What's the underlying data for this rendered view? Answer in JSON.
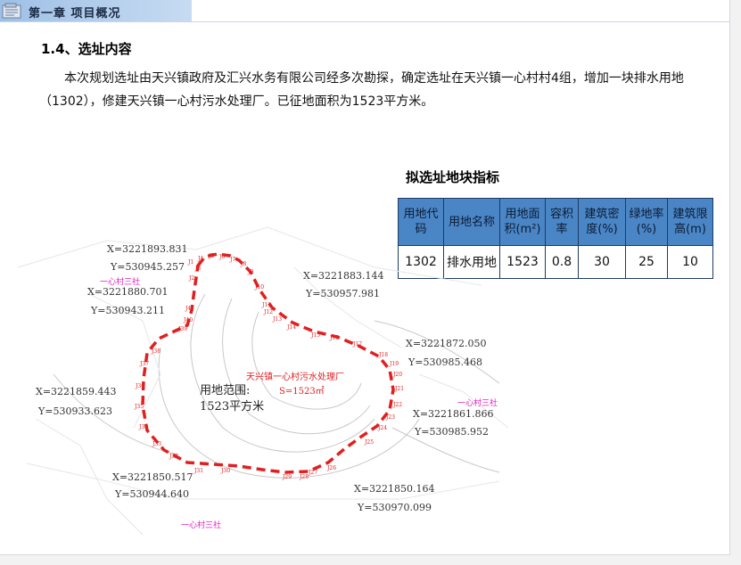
{
  "header": {
    "chapter_title": "第一章 项目概况",
    "icon": "folder-icon"
  },
  "section": {
    "title": "1.4、选址内容",
    "paragraph": "本次规划选址由天兴镇政府及汇兴水务有限公司经多次勘探，确定选址在天兴镇一心村村4组，增加一块排水用地（1302），修建天兴镇一心村污水处理厂。已征地面积为1523平方米。"
  },
  "table": {
    "title": "拟选址地块指标",
    "headers": [
      "用地代码",
      "用地名称",
      "用地面积(m²)",
      "容积率",
      "建筑密度(%)",
      "绿地率(%)",
      "建筑限高(m)"
    ],
    "rows": [
      [
        "1302",
        "排水用地",
        "1523",
        "0.8",
        "30",
        "25",
        "10"
      ]
    ],
    "header_color": "#4a86c5"
  },
  "map": {
    "boundary_color": "#e02020",
    "coords": [
      {
        "x": "X=3221893.831",
        "y": "Y=530945.257"
      },
      {
        "x": "X=3221880.701",
        "y": "Y=530943.211"
      },
      {
        "x": "X=3221883.144",
        "y": "Y=530957.981"
      },
      {
        "x": "X=3221872.050",
        "y": "Y=530985.468"
      },
      {
        "x": "X=3221859.443",
        "y": "Y=530933.623"
      },
      {
        "x": "X=3221861.866",
        "y": "Y=530985.952"
      },
      {
        "x": "X=3221850.517",
        "y": "Y=530944.640"
      },
      {
        "x": "X=3221850.164",
        "y": "Y=530970.099"
      }
    ],
    "village_labels": [
      "一心村三社",
      "一心村三社",
      "一心村三社"
    ],
    "area_label_1": "用地范围:",
    "area_label_2": "1523平方米",
    "plant_label": "天兴镇一心村污水处理厂",
    "plant_area": "S=1523㎡",
    "points": [
      "J1",
      "J2",
      "J3",
      "J4",
      "J5",
      "J6",
      "J7",
      "J8",
      "J9",
      "J10",
      "J11",
      "J12",
      "J13",
      "J14",
      "J15",
      "J16",
      "J17",
      "J18",
      "J19",
      "J20",
      "J21",
      "J22",
      "J23",
      "J24",
      "J25",
      "J26",
      "J27",
      "J28",
      "J29",
      "J30",
      "J31",
      "J32",
      "J33",
      "J34",
      "J35",
      "J36",
      "J37",
      "J38",
      "J39",
      "J40",
      "J41"
    ]
  }
}
